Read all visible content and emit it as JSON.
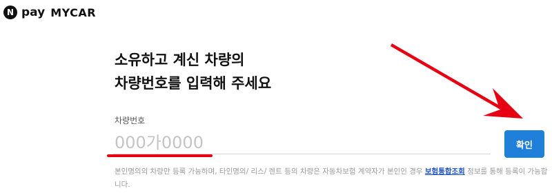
{
  "header": {
    "badge_letter": "N",
    "pay": "pay",
    "mycar": "MYCAR"
  },
  "heading": {
    "line1": "소유하고 계신 차량의",
    "line2": "차량번호를 입력해 주세요"
  },
  "form": {
    "label": "차량번호",
    "placeholder": "000가0000",
    "value": ""
  },
  "button": {
    "confirm_label": "확인"
  },
  "notice": {
    "text_before": "본인명의의 차량만 등록 가능하며, 타인명의/ 리스/ 렌트 등의 차량은 자동차보험 계약자가 본인인 경우 ",
    "link": "보험통합조회",
    "text_after": " 정보를 통해 등록이 가능합니다."
  },
  "colors": {
    "accent_blue": "#1f7fd9",
    "annotation_red": "#e60012",
    "link_blue": "#1a4fc4"
  }
}
